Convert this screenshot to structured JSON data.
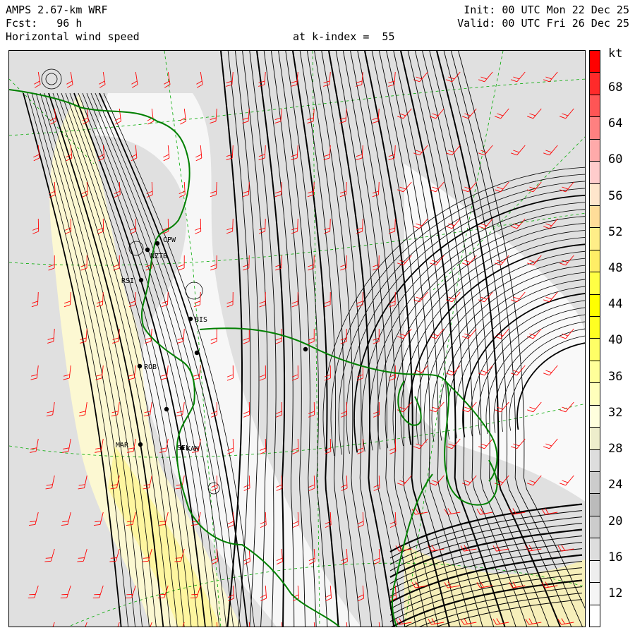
{
  "header": {
    "model": "AMPS 2.67-km WRF",
    "forecast": "Fcst:   96 h",
    "field": "Horizontal wind speed",
    "level": "at k-index =  55",
    "init": "Init: 00 UTC Mon 22 Dec 25",
    "valid": "Valid: 00 UTC Fri 26 Dec 25"
  },
  "colorbar": {
    "unit": "kt",
    "tick_labels": [
      "68",
      "64",
      "60",
      "56",
      "52",
      "48",
      "44",
      "40",
      "36",
      "32",
      "28",
      "24",
      "20",
      "16",
      "12"
    ],
    "colors": [
      "#ff0000",
      "#ff2a2a",
      "#ff5555",
      "#ff8080",
      "#ffaaaa",
      "#ffcccc",
      "#ffe6cc",
      "#ffdd99",
      "#ffee88",
      "#ffee66",
      "#ffff44",
      "#ffff00",
      "#ffff22",
      "#ffff66",
      "#ffff99",
      "#ffffbb",
      "#ffffdd",
      "#eeeecc",
      "#dddddd",
      "#cccccc",
      "#bbbbbb",
      "#cccccc",
      "#dddddd",
      "#eeeeee",
      "#f5f5f5",
      "#ffffff"
    ]
  },
  "stations": [
    {
      "id": "CPW"
    },
    {
      "id": "NZTB"
    },
    {
      "id": "RSI"
    },
    {
      "id": "BIS"
    },
    {
      "id": "ROB"
    },
    {
      "id": "KAN"
    },
    {
      "id": "SEL"
    },
    {
      "id": "MAR"
    }
  ],
  "map_colors": {
    "coastline": "#008000",
    "streamlines": "#000000",
    "barbs": "#ff0000",
    "gridlines": "#00aa00"
  }
}
